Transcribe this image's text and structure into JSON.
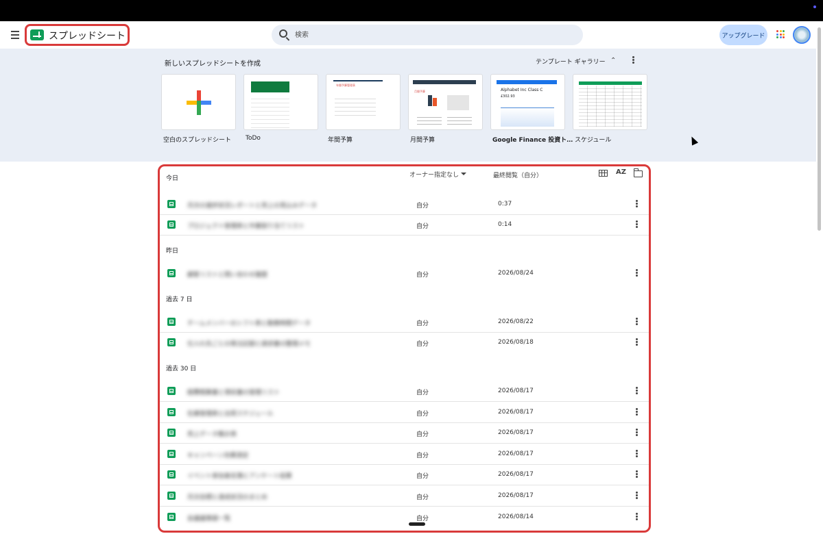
{
  "app": {
    "title": "スプレッドシート"
  },
  "search": {
    "placeholder": "検索"
  },
  "header": {
    "upgrade_label": "アップグレード"
  },
  "templates": {
    "heading": "新しいスプレッドシートを作成",
    "gallery_label": "テンプレート ギャラリー",
    "items": [
      {
        "label": "空白のスプレッドシート"
      },
      {
        "label": "ToDo"
      },
      {
        "label": "年間予算"
      },
      {
        "label": "月間予算"
      },
      {
        "label": "Google Finance 投資ト…"
      },
      {
        "label": "スケジュール"
      }
    ],
    "thumb_text": {
      "annual_title": "年間予算管理表",
      "monthly_title": "月間予算",
      "finance_title": "Alphabet Inc Class C",
      "finance_price": "£302.93"
    }
  },
  "recent": {
    "owner_filter": "オーナー指定なし",
    "date_column": "最終閲覧（自分）",
    "sort_label": "AZ",
    "sections": [
      {
        "label": "今日",
        "rows": [
          {
            "name": "月次の進捗状況レポートと売上の見込みデータ",
            "owner": "自分",
            "date": "0:37"
          },
          {
            "name": "プロジェクト管理表と作業割り当てリスト",
            "owner": "自分",
            "date": "0:14"
          }
        ]
      },
      {
        "label": "昨日",
        "rows": [
          {
            "name": "顧客リストと問い合わせ履歴",
            "owner": "自分",
            "date": "2026/08/24"
          }
        ]
      },
      {
        "label": "過去 7 日",
        "rows": [
          {
            "name": "チームメンバーのシフト表と勤務時間データ",
            "owner": "自分",
            "date": "2026/08/22"
          },
          {
            "name": "仕入れ先ごとの発注記録と請求書の整理メモ",
            "owner": "自分",
            "date": "2026/08/18"
          }
        ]
      },
      {
        "label": "過去 30 日",
        "rows": [
          {
            "name": "経費精算書と領収書の管理リスト",
            "owner": "自分",
            "date": "2026/08/17"
          },
          {
            "name": "在庫管理表と出荷スケジュール",
            "owner": "自分",
            "date": "2026/08/17"
          },
          {
            "name": "売上データ集計表",
            "owner": "自分",
            "date": "2026/08/17"
          },
          {
            "name": "キャンペーン効果測定",
            "owner": "自分",
            "date": "2026/08/17"
          },
          {
            "name": "イベント参加者名簿とアンケート結果",
            "owner": "自分",
            "date": "2026/08/17"
          },
          {
            "name": "月次目標と達成状況のまとめ",
            "owner": "自分",
            "date": "2026/08/17"
          },
          {
            "name": "会議議事録一覧",
            "owner": "自分",
            "date": "2026/08/14"
          }
        ]
      }
    ]
  },
  "colors": {
    "accent_red": "#d93a3a",
    "sheets_green": "#0f9d58",
    "template_bg": "#e9eef6"
  }
}
